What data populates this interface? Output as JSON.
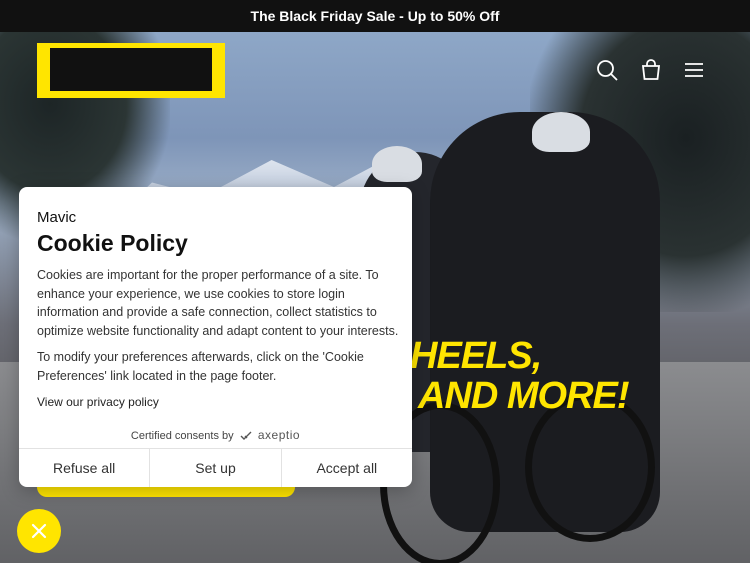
{
  "announcement": {
    "text": "The Black Friday Sale - Up to 50% Off"
  },
  "header": {
    "icons": {
      "search": "search-icon",
      "cart": "cart-icon",
      "menu": "menu-icon"
    }
  },
  "hero": {
    "headline_line1": "HEELS,",
    "headline_line2": "AND MORE!",
    "accent_color": "#ffe500"
  },
  "cookie_modal": {
    "brand": "Mavic",
    "title": "Cookie Policy",
    "paragraph1": "Cookies are important for the proper performance of a site. To enhance your experience, we use cookies to store login information and provide a safe connection, collect statistics to optimize website functionality and adapt content to your interests.",
    "paragraph2": "To modify your preferences afterwards, click on the 'Cookie Preferences' link located in the page footer.",
    "privacy_link": "View our privacy policy",
    "certified_label": "Certified consents by",
    "certified_brand": "axeptio",
    "buttons": {
      "refuse": "Refuse all",
      "setup": "Set up",
      "accept": "Accept all"
    }
  },
  "floating_button": {
    "icon": "close-icon"
  }
}
